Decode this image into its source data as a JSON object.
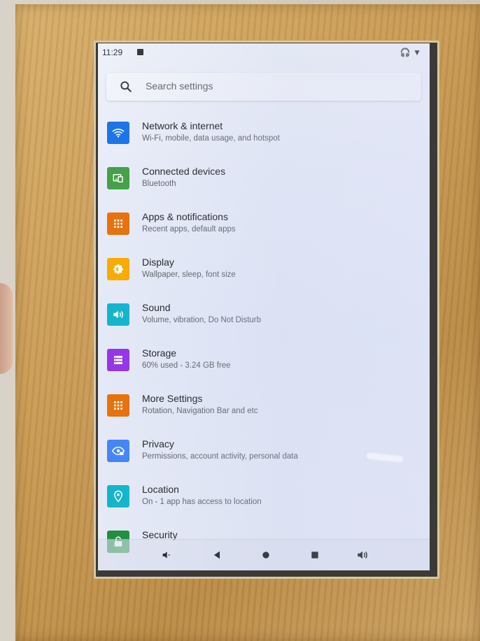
{
  "status_bar": {
    "time": "11:29",
    "right_icons": "🎧 ▼"
  },
  "search": {
    "placeholder": "Search settings"
  },
  "settings": [
    {
      "title": "Network & internet",
      "subtitle": "Wi-Fi, mobile, data usage, and hotspot",
      "icon": "wifi-icon",
      "color": "#1a73e8"
    },
    {
      "title": "Connected devices",
      "subtitle": "Bluetooth",
      "icon": "devices-icon",
      "color": "#43a047"
    },
    {
      "title": "Apps & notifications",
      "subtitle": "Recent apps, default apps",
      "icon": "apps-grid-icon",
      "color": "#e8710a"
    },
    {
      "title": "Display",
      "subtitle": "Wallpaper, sleep, font size",
      "icon": "brightness-icon",
      "color": "#f9ab00"
    },
    {
      "title": "Sound",
      "subtitle": "Volume, vibration, Do Not Disturb",
      "icon": "volume-icon",
      "color": "#12b5cb"
    },
    {
      "title": "Storage",
      "subtitle": "60% used - 3.24 GB free",
      "icon": "storage-icon",
      "color": "#9334e6"
    },
    {
      "title": "More Settings",
      "subtitle": "Rotation, Navigation Bar and etc",
      "icon": "apps-grid-icon",
      "color": "#e8710a"
    },
    {
      "title": "Privacy",
      "subtitle": "Permissions, account activity, personal data",
      "icon": "privacy-icon",
      "color": "#4285f4"
    },
    {
      "title": "Location",
      "subtitle": "On - 1 app has access to location",
      "icon": "location-icon",
      "color": "#12b5cb"
    },
    {
      "title": "Security",
      "subtitle": "",
      "icon": "lock-icon",
      "color": "#1e8e3e"
    }
  ],
  "navigation_bar": {
    "buttons": [
      "volume-down-icon",
      "back-icon",
      "home-icon",
      "recents-icon",
      "volume-up-icon"
    ]
  }
}
